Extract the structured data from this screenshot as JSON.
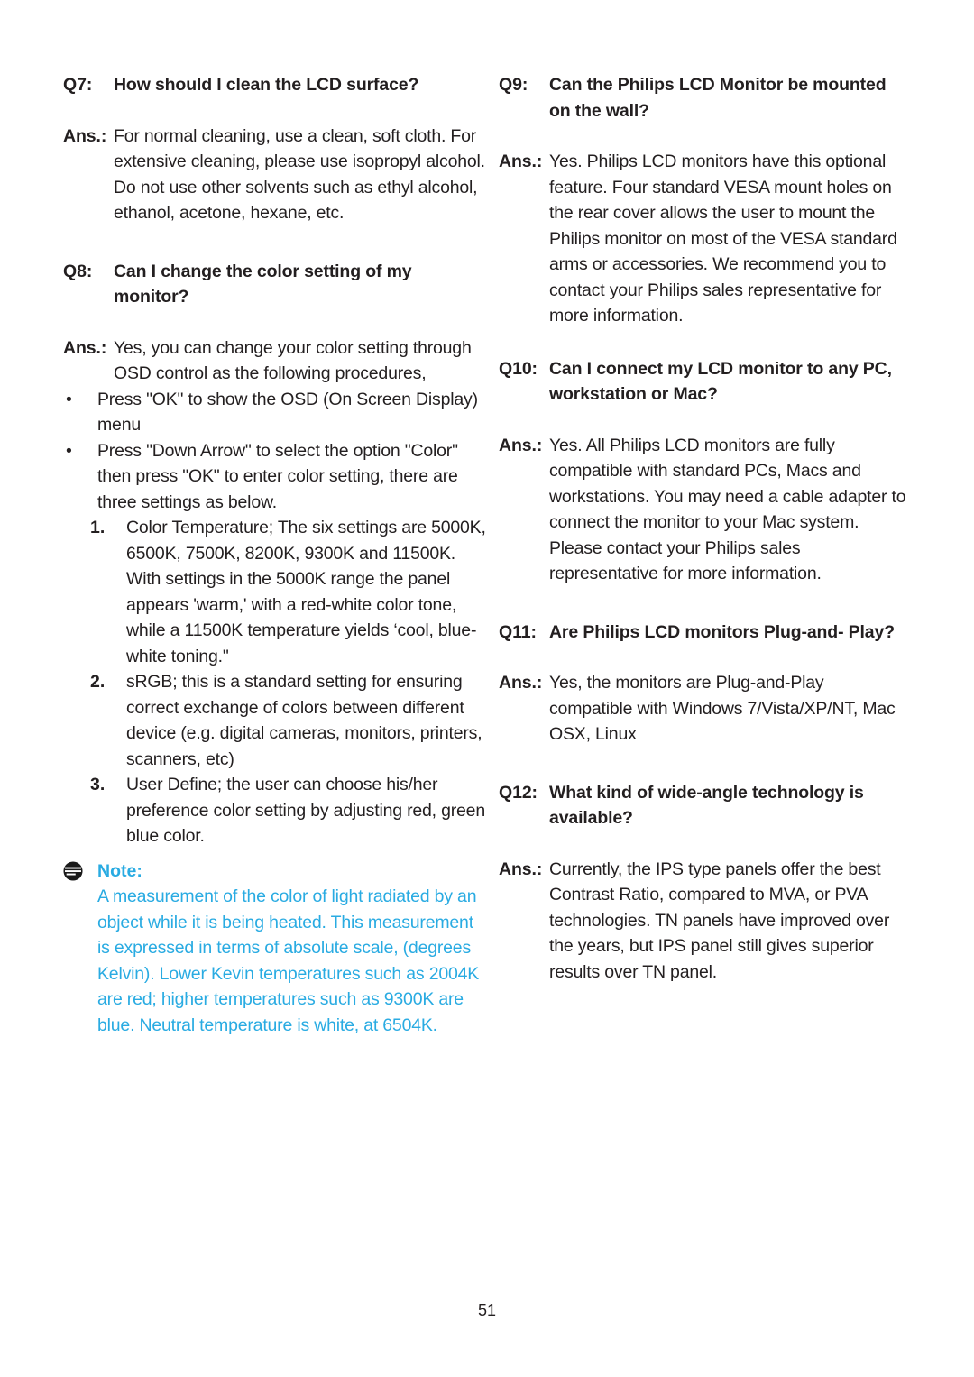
{
  "page": {
    "number": "51",
    "note_color": "#29abe2"
  },
  "left_column": {
    "q7": {
      "label": "Q7:",
      "question": "How should I clean the LCD surface?",
      "ans_label": "Ans.:",
      "answer": "For normal cleaning, use a clean, soft cloth. For extensive cleaning, please use isopropyl alcohol. Do not use other solvents such as ethyl alcohol, ethanol, acetone, hexane, etc."
    },
    "q8": {
      "label": "Q8:",
      "question": "Can I change the color setting of my monitor?",
      "ans_label": "Ans.:",
      "answer": "Yes, you can change your color setting through OSD control as the following procedures,",
      "bullets": [
        {
          "mark": "•",
          "text": "Press \"OK\" to show the OSD (On Screen Display) menu"
        },
        {
          "mark": "•",
          "text": "Press \"Down Arrow\" to select the option \"Color\" then press \"OK\" to enter color setting, there are three settings as below."
        }
      ],
      "numbered": [
        {
          "mark": "1.",
          "text": "Color Temperature; The six settings are 5000K, 6500K, 7500K, 8200K, 9300K and 11500K. With settings in the 5000K range the panel appears 'warm,' with a red-white color tone, while a 11500K temperature yields ‘cool, blue-white toning.\""
        },
        {
          "mark": "2.",
          "text": "sRGB; this is a standard setting for ensuring correct exchange of colors between different device (e.g. digital cameras, monitors, printers, scanners, etc)"
        },
        {
          "mark": "3.",
          "text": "User Define; the user can choose his/her preference color setting by adjusting red, green blue color."
        }
      ],
      "note": {
        "title": "Note:",
        "body": "A measurement of the color of light radiated by an object while it is being heated. This measurement is expressed in terms of absolute scale, (degrees Kelvin). Lower Kevin temperatures such as 2004K are red; higher temperatures such as 9300K are blue. Neutral temperature is white, at 6504K."
      }
    }
  },
  "right_column": {
    "q9": {
      "label": "Q9:",
      "question": "Can the Philips LCD Monitor be mounted on the wall?",
      "ans_label": "Ans.:",
      "answer": "Yes. Philips LCD monitors have this optional feature. Four standard VESA mount holes on the rear cover allows the user to mount the Philips monitor on most of the VESA standard arms or accessories. We recommend you to contact your Philips sales representative for more information."
    },
    "q10": {
      "label": "Q10:",
      "question": "Can I connect my LCD monitor to any PC, workstation or Mac?",
      "ans_label": "Ans.:",
      "answer": "Yes. All Philips LCD monitors are fully compatible with standard PCs, Macs and workstations. You may need a cable adapter to connect the monitor to your Mac system. Please contact your Philips sales representative for more information."
    },
    "q11": {
      "label": "Q11:",
      "question": "Are Philips LCD monitors Plug-and- Play?",
      "ans_label": "Ans.:",
      "answer": "Yes, the monitors are Plug-and-Play compatible with Windows 7/Vista/XP/NT, Mac OSX, Linux"
    },
    "q12": {
      "label": "Q12:",
      "question": "What kind of wide-angle technology is available?",
      "ans_label": "Ans.:",
      "answer": "Currently, the IPS type panels offer the best Contrast Ratio, compared to MVA, or PVA technologies. TN panels have improved over the years, but IPS panel still gives superior results over TN panel."
    }
  }
}
